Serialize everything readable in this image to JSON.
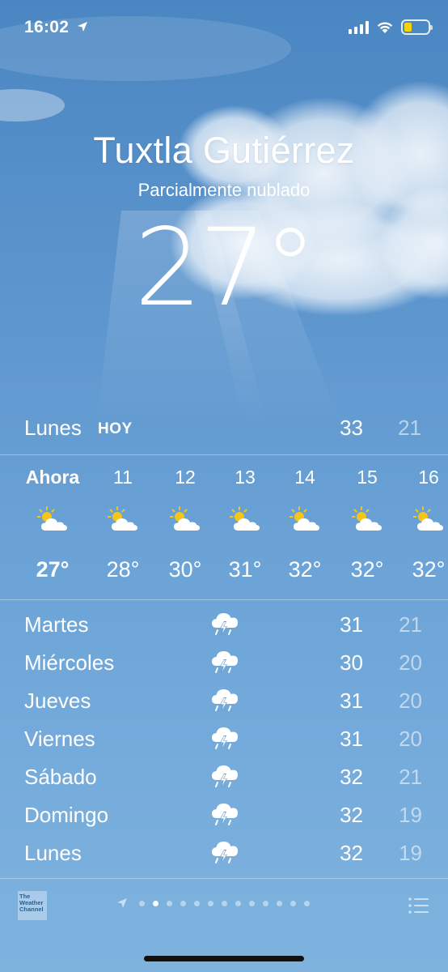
{
  "status_bar": {
    "time": "16:02"
  },
  "location": {
    "city": "Tuxtla Gutiérrez",
    "condition": "Parcialmente nublado",
    "temperature": "27°"
  },
  "today": {
    "day": "Lunes",
    "badge": "HOY",
    "high": "33",
    "low": "21"
  },
  "hourly": [
    {
      "label": "Ahora",
      "icon": "partly-sunny-icon",
      "temp": "27°"
    },
    {
      "label": "11",
      "icon": "partly-sunny-icon",
      "temp": "28°"
    },
    {
      "label": "12",
      "icon": "partly-sunny-icon",
      "temp": "30°"
    },
    {
      "label": "13",
      "icon": "partly-sunny-icon",
      "temp": "31°"
    },
    {
      "label": "14",
      "icon": "partly-sunny-icon",
      "temp": "32°"
    },
    {
      "label": "15",
      "icon": "partly-sunny-icon",
      "temp": "32°"
    },
    {
      "label": "16",
      "icon": "partly-sunny-icon",
      "temp": "32°"
    }
  ],
  "daily": [
    {
      "day": "Martes",
      "icon": "thunderstorm-icon",
      "high": "31",
      "low": "21"
    },
    {
      "day": "Miércoles",
      "icon": "thunderstorm-icon",
      "high": "30",
      "low": "20"
    },
    {
      "day": "Jueves",
      "icon": "thunderstorm-icon",
      "high": "31",
      "low": "20"
    },
    {
      "day": "Viernes",
      "icon": "thunderstorm-icon",
      "high": "31",
      "low": "20"
    },
    {
      "day": "Sábado",
      "icon": "thunderstorm-icon",
      "high": "32",
      "low": "21"
    },
    {
      "day": "Domingo",
      "icon": "thunderstorm-icon",
      "high": "32",
      "low": "19"
    },
    {
      "day": "Lunes",
      "icon": "thunderstorm-icon",
      "high": "32",
      "low": "19"
    }
  ],
  "footer": {
    "logo_text": [
      "The",
      "Weather",
      "Channel"
    ],
    "page_count": 13,
    "active_page": 1
  },
  "colors": {
    "sky_top": "#4a86c2",
    "sky_bottom": "#7fb3de",
    "sun": "#f5c518",
    "battery": "#f5d20a"
  }
}
